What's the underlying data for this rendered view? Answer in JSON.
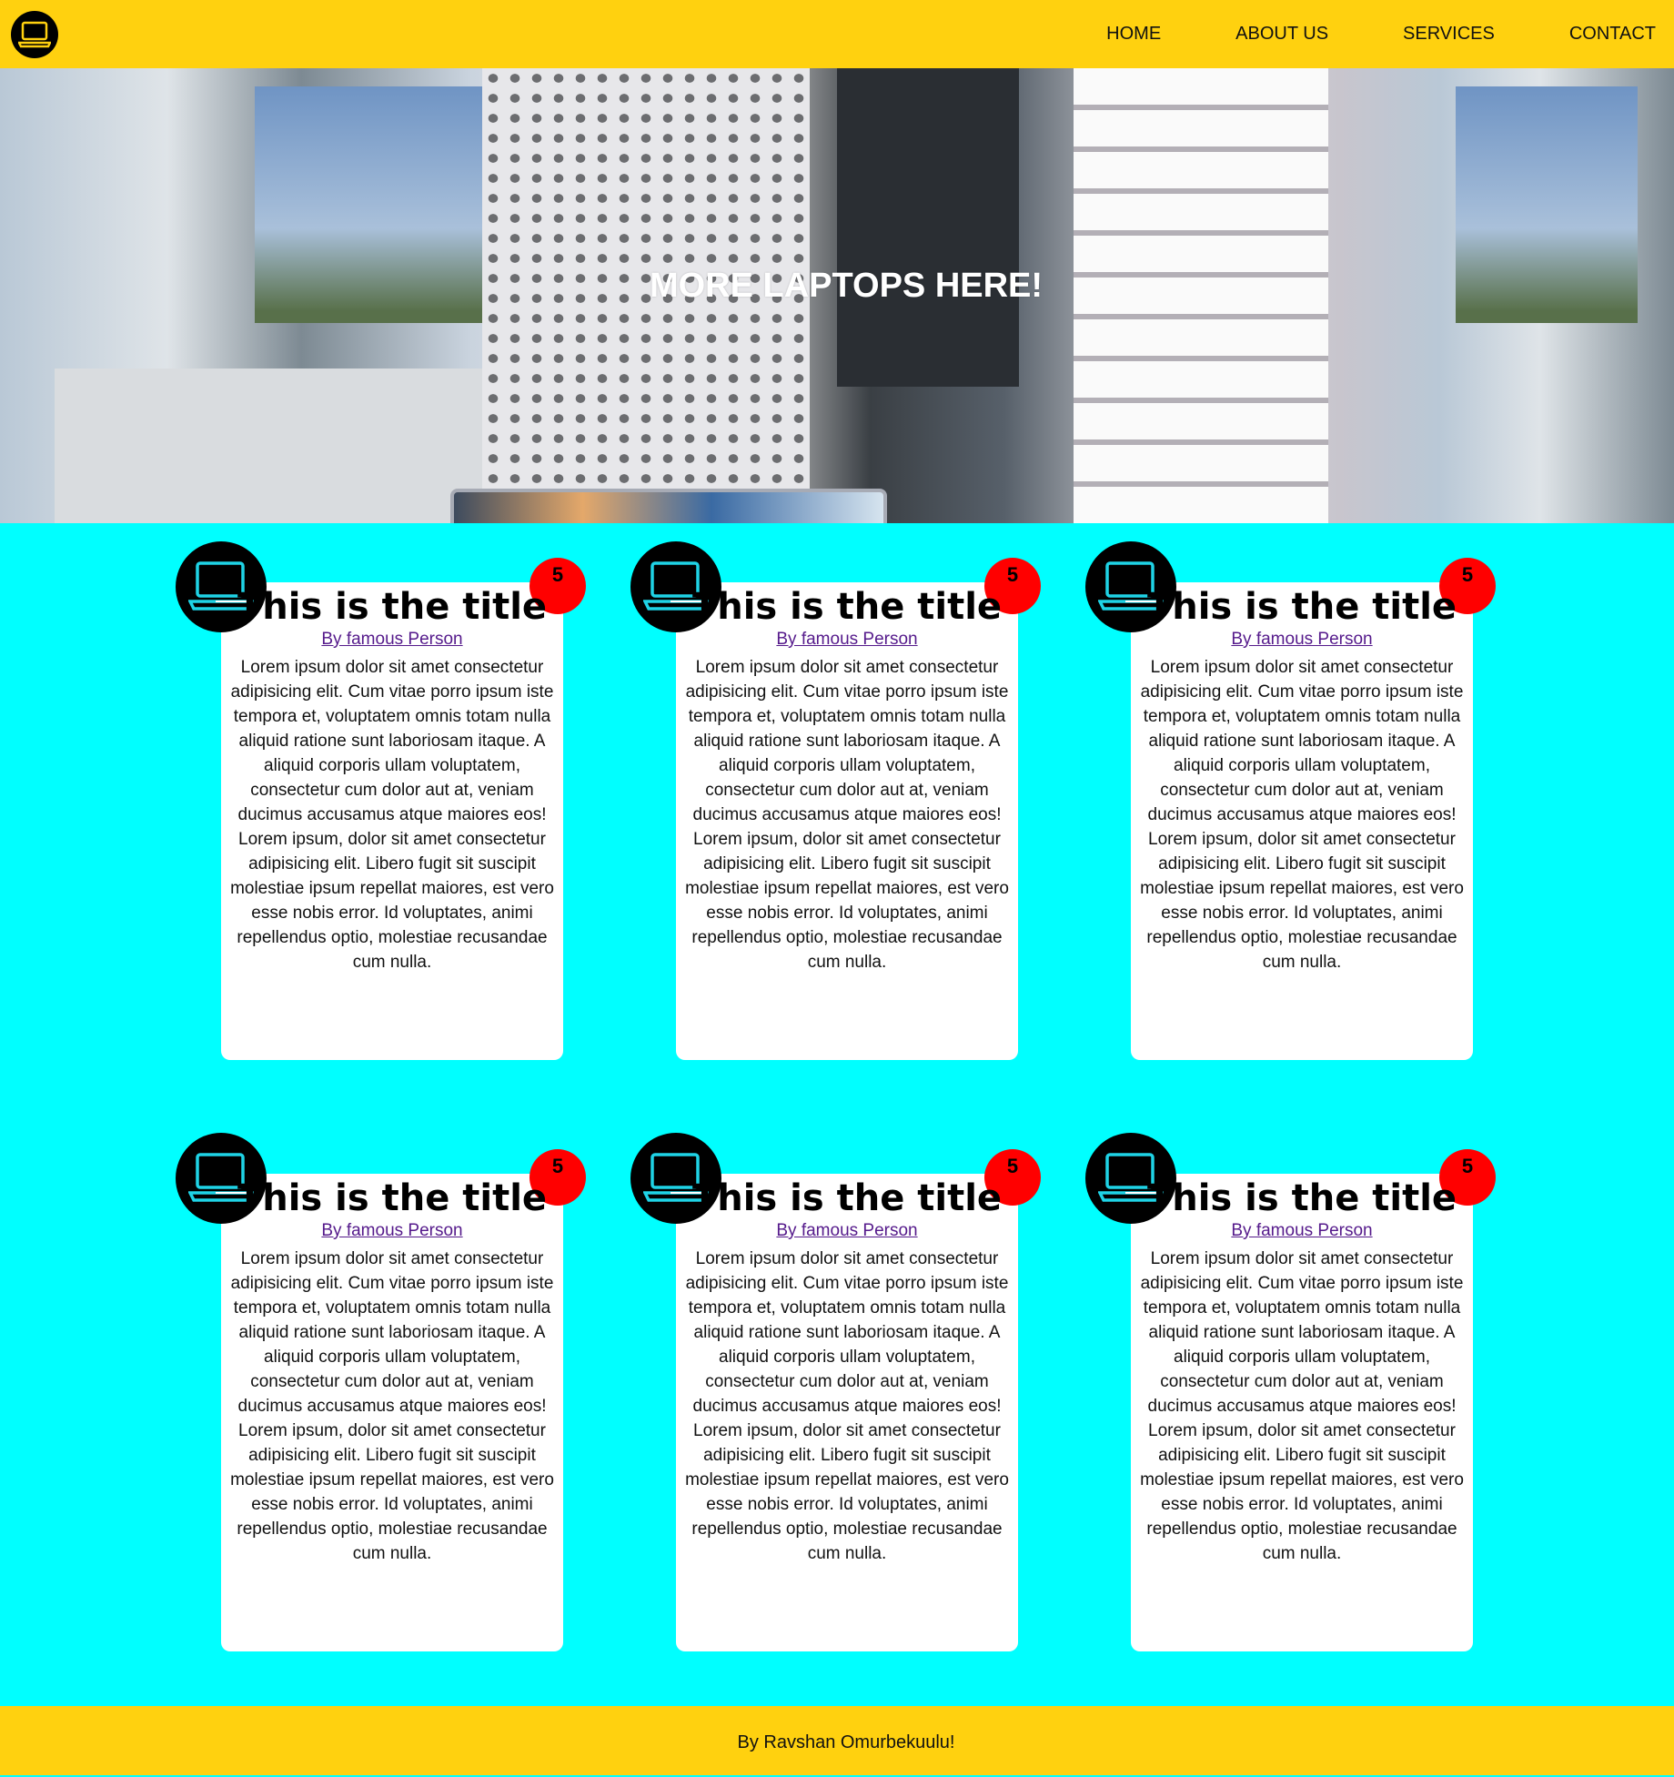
{
  "header": {
    "logo_icon": "laptop-icon",
    "nav": [
      "HOME",
      "ABOUT US",
      "SERVICES",
      "CONTACT"
    ]
  },
  "hero": {
    "title": "MORE LAPTOPS HERE!"
  },
  "cards": [
    {
      "title": "This is the title",
      "author": "By famous Person",
      "badge": "5",
      "icon": "laptop-icon",
      "body": "Lorem ipsum dolor sit amet consectetur adipisicing elit. Cum vitae porro ipsum iste tempora et, voluptatem omnis totam nulla aliquid ratione sunt laboriosam itaque. A aliquid corporis ullam voluptatem, consectetur cum dolor aut at, veniam ducimus accusamus atque maiores eos! Lorem ipsum, dolor sit amet consectetur adipisicing elit. Libero fugit sit suscipit molestiae ipsum repellat maiores, est vero esse nobis error. Id voluptates, animi repellendus optio, molestiae recusandae cum nulla."
    },
    {
      "title": "This is the title",
      "author": "By famous Person",
      "badge": "5",
      "icon": "laptop-icon",
      "body": "Lorem ipsum dolor sit amet consectetur adipisicing elit. Cum vitae porro ipsum iste tempora et, voluptatem omnis totam nulla aliquid ratione sunt laboriosam itaque. A aliquid corporis ullam voluptatem, consectetur cum dolor aut at, veniam ducimus accusamus atque maiores eos! Lorem ipsum, dolor sit amet consectetur adipisicing elit. Libero fugit sit suscipit molestiae ipsum repellat maiores, est vero esse nobis error. Id voluptates, animi repellendus optio, molestiae recusandae cum nulla."
    },
    {
      "title": "This is the title",
      "author": "By famous Person",
      "badge": "5",
      "icon": "laptop-icon",
      "body": "Lorem ipsum dolor sit amet consectetur adipisicing elit. Cum vitae porro ipsum iste tempora et, voluptatem omnis totam nulla aliquid ratione sunt laboriosam itaque. A aliquid corporis ullam voluptatem, consectetur cum dolor aut at, veniam ducimus accusamus atque maiores eos! Lorem ipsum, dolor sit amet consectetur adipisicing elit. Libero fugit sit suscipit molestiae ipsum repellat maiores, est vero esse nobis error. Id voluptates, animi repellendus optio, molestiae recusandae cum nulla."
    },
    {
      "title": "This is the title",
      "author": "By famous Person",
      "badge": "5",
      "icon": "laptop-icon",
      "body": "Lorem ipsum dolor sit amet consectetur adipisicing elit. Cum vitae porro ipsum iste tempora et, voluptatem omnis totam nulla aliquid ratione sunt laboriosam itaque. A aliquid corporis ullam voluptatem, consectetur cum dolor aut at, veniam ducimus accusamus atque maiores eos! Lorem ipsum, dolor sit amet consectetur adipisicing elit. Libero fugit sit suscipit molestiae ipsum repellat maiores, est vero esse nobis error. Id voluptates, animi repellendus optio, molestiae recusandae cum nulla."
    },
    {
      "title": "This is the title",
      "author": "By famous Person",
      "badge": "5",
      "icon": "laptop-icon",
      "body": "Lorem ipsum dolor sit amet consectetur adipisicing elit. Cum vitae porro ipsum iste tempora et, voluptatem omnis totam nulla aliquid ratione sunt laboriosam itaque. A aliquid corporis ullam voluptatem, consectetur cum dolor aut at, veniam ducimus accusamus atque maiores eos! Lorem ipsum, dolor sit amet consectetur adipisicing elit. Libero fugit sit suscipit molestiae ipsum repellat maiores, est vero esse nobis error. Id voluptates, animi repellendus optio, molestiae recusandae cum nulla."
    },
    {
      "title": "This is the title",
      "author": "By famous Person",
      "badge": "5",
      "icon": "laptop-icon",
      "body": "Lorem ipsum dolor sit amet consectetur adipisicing elit. Cum vitae porro ipsum iste tempora et, voluptatem omnis totam nulla aliquid ratione sunt laboriosam itaque. A aliquid corporis ullam voluptatem, consectetur cum dolor aut at, veniam ducimus accusamus atque maiores eos! Lorem ipsum, dolor sit amet consectetur adipisicing elit. Libero fugit sit suscipit molestiae ipsum repellat maiores, est vero esse nobis error. Id voluptates, animi repellendus optio, molestiae recusandae cum nulla."
    }
  ],
  "footer": {
    "text": "By Ravshan Omurbekuulu!"
  },
  "colors": {
    "header_bg": "#ffd10f",
    "page_bg": "#00ffff",
    "badge_bg": "#ff0000",
    "icon_stroke": "#1fd3e6",
    "logo_stroke": "#ffd10f"
  }
}
